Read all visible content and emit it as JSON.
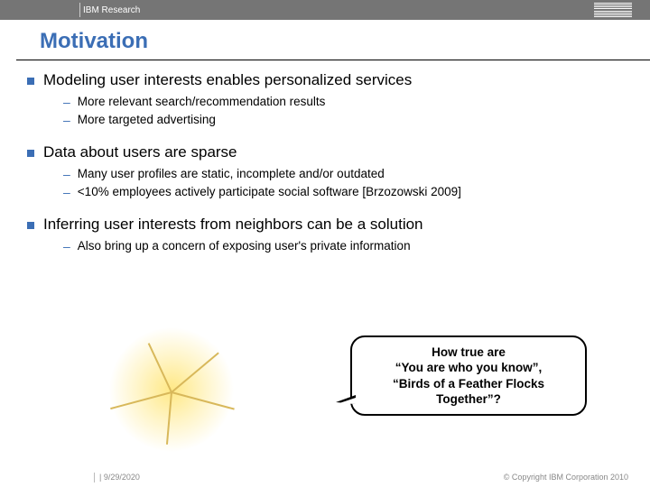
{
  "header": {
    "brand": "IBM Research"
  },
  "title": "Motivation",
  "bullets": [
    {
      "text": "Modeling user interests enables personalized services",
      "subs": [
        "More relevant search/recommendation results",
        "More targeted advertising"
      ]
    },
    {
      "text": "Data about users are sparse",
      "subs": [
        "Many user profiles are static, incomplete and/or outdated",
        "<10% employees actively participate social software [Brzozowski 2009]"
      ]
    },
    {
      "text": "Inferring user interests from neighbors can be a solution",
      "subs": [
        "Also bring up a concern of exposing user's private information"
      ]
    }
  ],
  "callout": {
    "line1": "How true are",
    "line2": "“You are who you know”,",
    "line3": "“Birds of a Feather Flocks",
    "line4": "Together”?"
  },
  "footer": {
    "date": "| 9/29/2020",
    "copyright": "© Copyright IBM Corporation 2010"
  }
}
